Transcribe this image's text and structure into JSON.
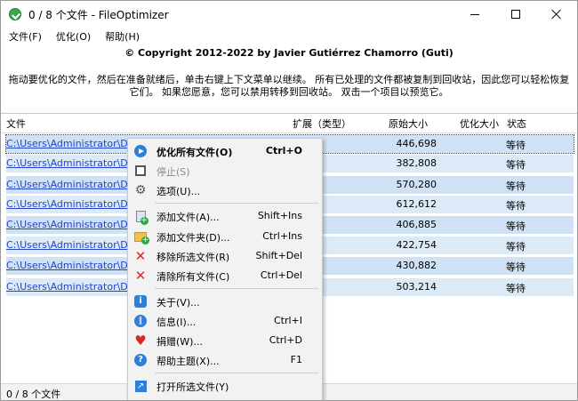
{
  "window": {
    "title": "0 / 8 个文件 - FileOptimizer",
    "icons": {
      "app": "fileoptimizer-check-icon",
      "minimize": "minimize-icon",
      "maximize": "maximize-icon",
      "close": "close-icon"
    }
  },
  "menubar": {
    "items": [
      {
        "label": "文件(F)"
      },
      {
        "label": "优化(O)"
      },
      {
        "label": "帮助(H)"
      }
    ]
  },
  "copyright": "© Copyright 2012-2022 by Javier Gutiérrez Chamorro (Guti)",
  "description": "拖动要优化的文件，然后在准备就绪后，单击右键上下文菜单以继续。 所有已处理的文件都被复制到回收站，因此您可以轻松恢复它们。 如果您愿意，您可以禁用转移到回收站。 双击一个项目以预览它。",
  "list": {
    "columns": {
      "file": "文件",
      "ext": "扩展（类型）",
      "orig": "原始大小",
      "opt": "优化大小",
      "status": "状态"
    },
    "rows": [
      {
        "path": "C:\\Users\\Administrator\\Desk",
        "size": "446,698",
        "status": "等待"
      },
      {
        "path": "C:\\Users\\Administrator\\Desk",
        "size": "382,808",
        "status": "等待"
      },
      {
        "path": "C:\\Users\\Administrator\\Desk",
        "size": "570,280",
        "status": "等待"
      },
      {
        "path": "C:\\Users\\Administrator\\Desk",
        "size": "612,612",
        "status": "等待"
      },
      {
        "path": "C:\\Users\\Administrator\\Desk",
        "size": "406,885",
        "status": "等待"
      },
      {
        "path": "C:\\Users\\Administrator\\Desk",
        "size": "422,754",
        "status": "等待"
      },
      {
        "path": "C:\\Users\\Administrator\\Desk",
        "size": "430,882",
        "status": "等待"
      },
      {
        "path": "C:\\Users\\Administrator\\Desk",
        "size": "503,214",
        "status": "等待"
      }
    ]
  },
  "context_menu": {
    "items": [
      {
        "label": "优化所有文件(O)",
        "shortcut": "Ctrl+O",
        "icon": "play-icon"
      },
      {
        "label": "停止(S)",
        "shortcut": "",
        "icon": "stop-icon"
      },
      {
        "label": "选项(U)...",
        "shortcut": "",
        "icon": "gear-icon"
      },
      {
        "label": "添加文件(A)...",
        "shortcut": "Shift+Ins",
        "icon": "add-file-icon"
      },
      {
        "label": "添加文件夹(D)...",
        "shortcut": "Ctrl+Ins",
        "icon": "add-folder-icon"
      },
      {
        "label": "移除所选文件(R)",
        "shortcut": "Shift+Del",
        "icon": "remove-icon"
      },
      {
        "label": "清除所有文件(C)",
        "shortcut": "Ctrl+Del",
        "icon": "clear-icon"
      },
      {
        "label": "关于(V)...",
        "shortcut": "",
        "icon": "info-icon"
      },
      {
        "label": "信息(I)...",
        "shortcut": "Ctrl+I",
        "icon": "information-icon"
      },
      {
        "label": "捐赠(W)...",
        "shortcut": "Ctrl+D",
        "icon": "heart-icon"
      },
      {
        "label": "帮助主题(X)...",
        "shortcut": "F1",
        "icon": "help-icon"
      },
      {
        "label": "打开所选文件(Y)",
        "shortcut": "",
        "icon": "open-file-icon"
      }
    ]
  },
  "statusbar": {
    "text": "0 / 8 个文件"
  },
  "colors": {
    "row_selected": "#cfe2f5",
    "row_selected_alt": "#dce9f7",
    "link": "#2444c8",
    "accent_blue": "#2e7fd9",
    "remove_red": "#d62b2b",
    "add_green": "#2fa34a"
  }
}
